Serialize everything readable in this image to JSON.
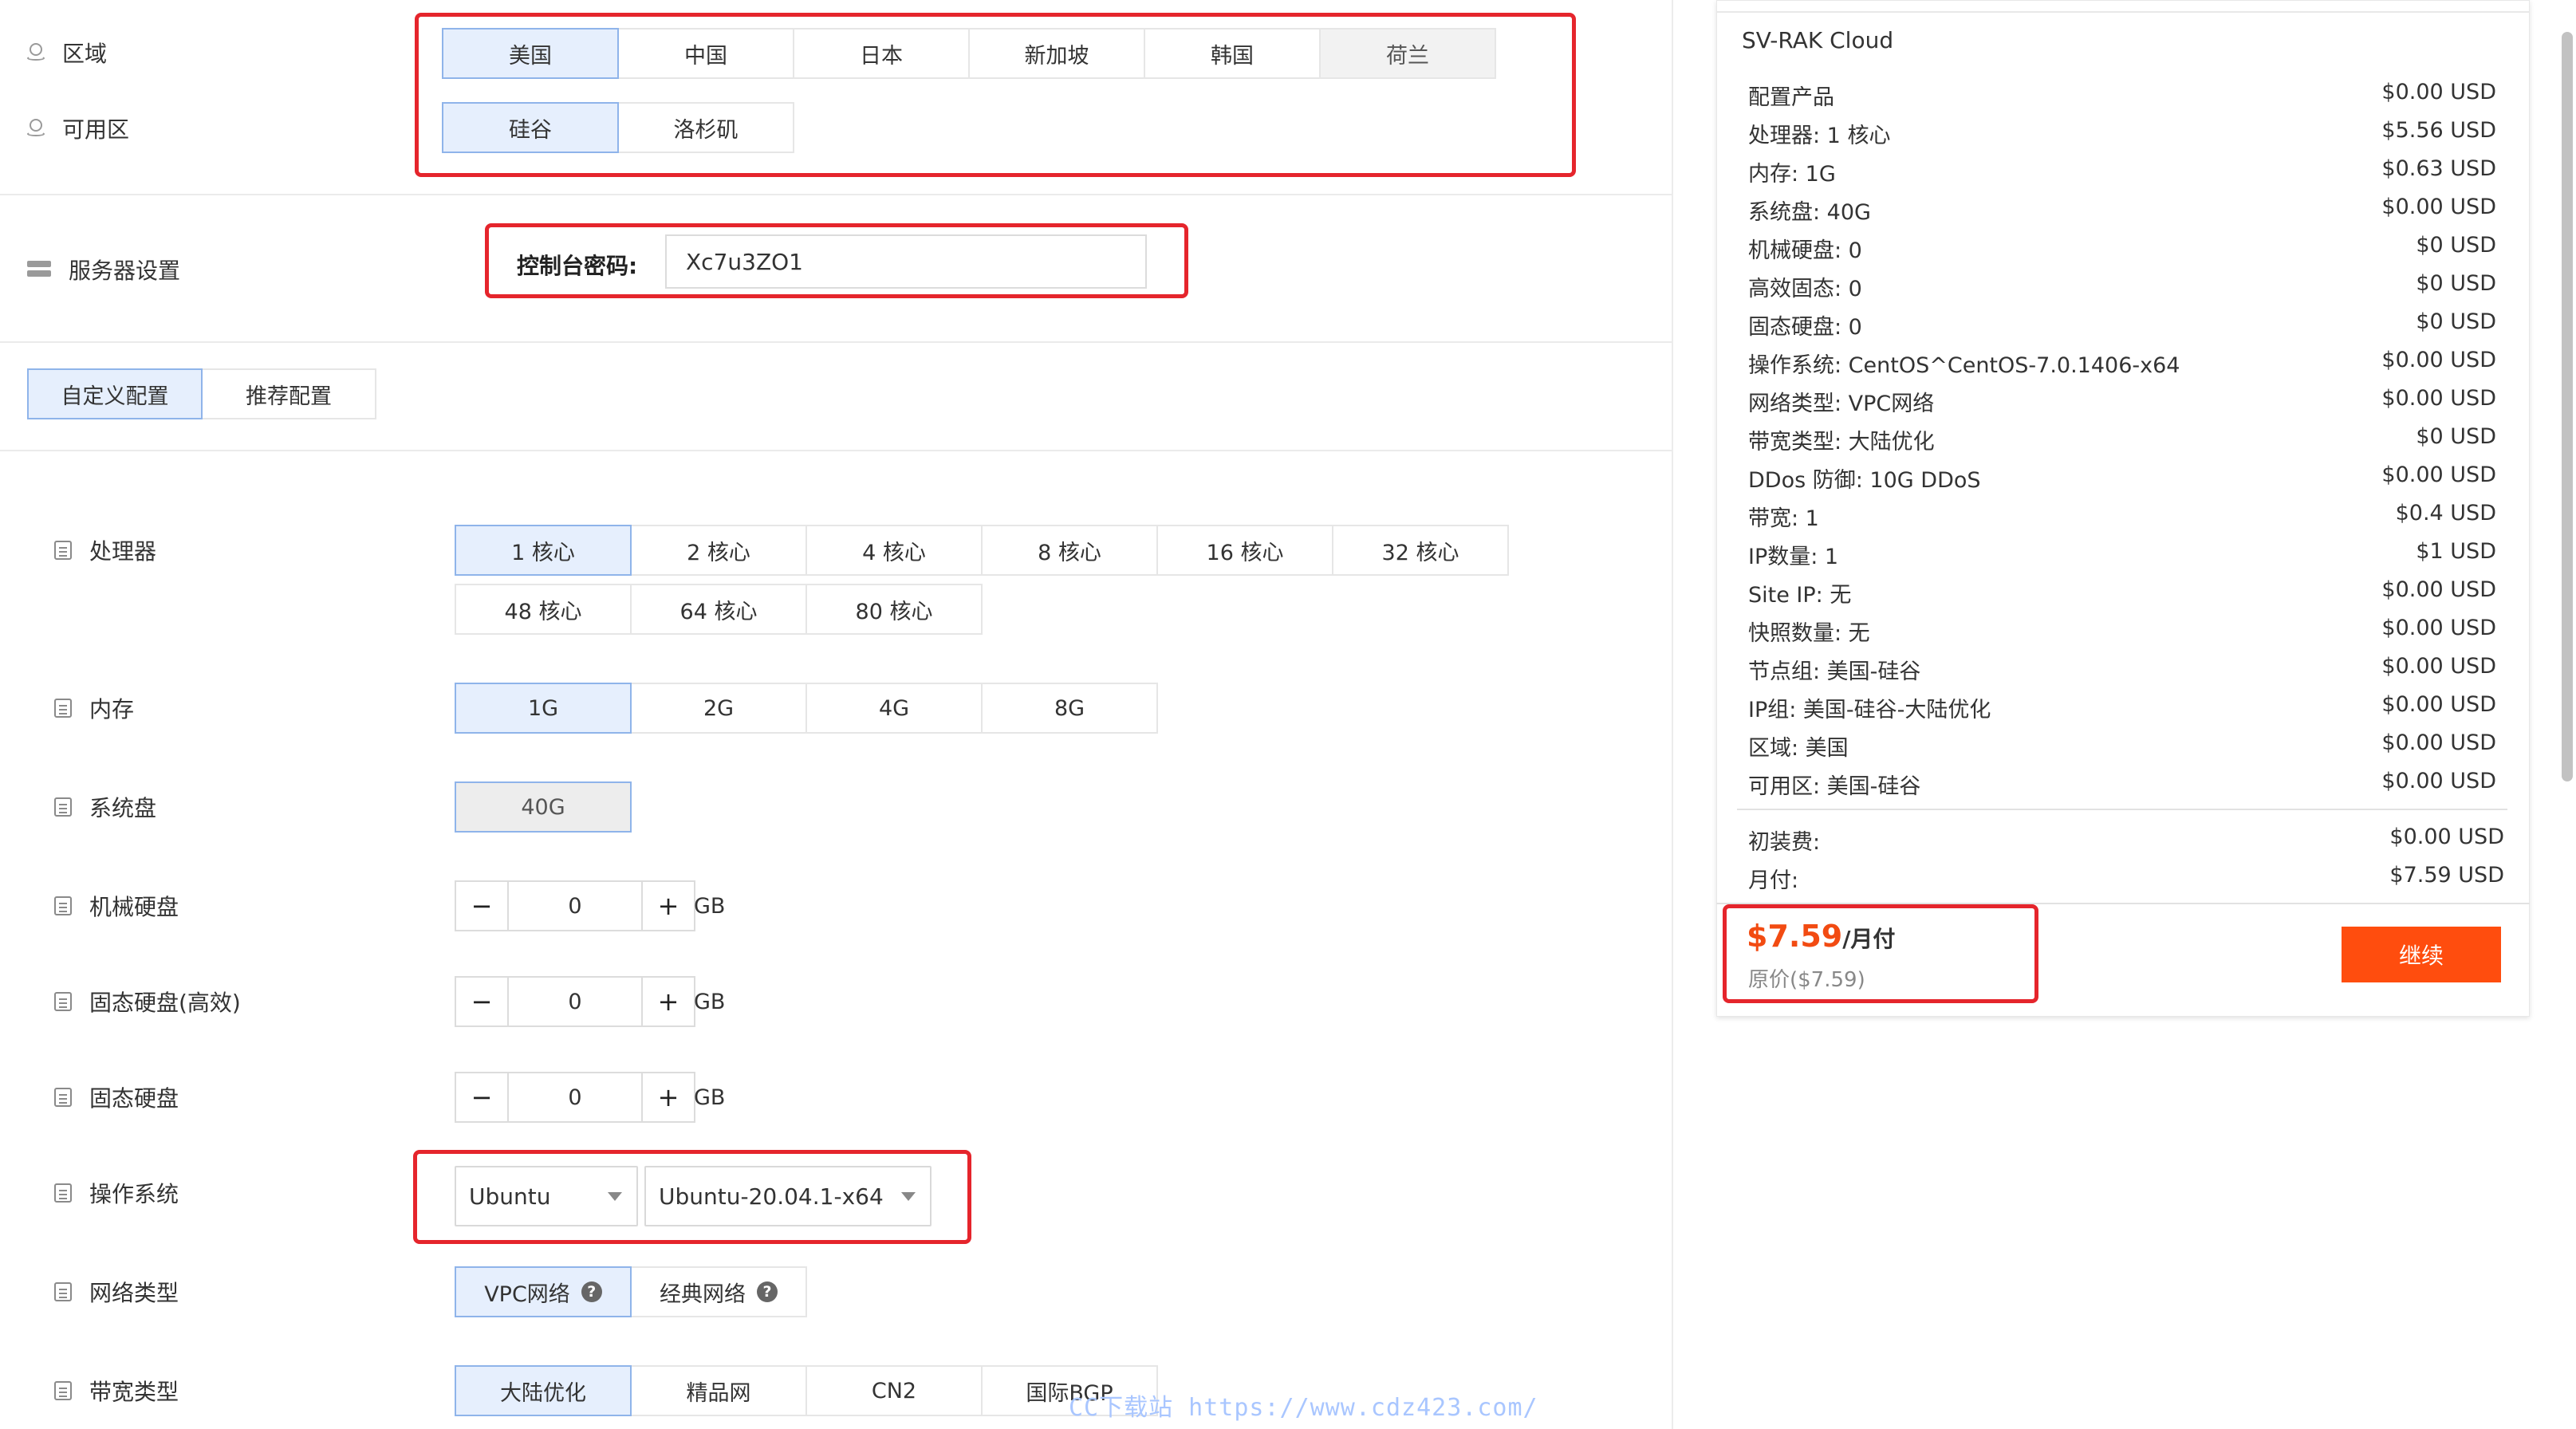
{
  "region": {
    "label": "区域",
    "options": [
      "美国",
      "中国",
      "日本",
      "新加坡",
      "韩国",
      "荷兰"
    ],
    "selected": "美国"
  },
  "zone": {
    "label": "可用区",
    "options": [
      "硅谷",
      "洛杉矶"
    ],
    "selected": "硅谷"
  },
  "server_settings": {
    "label": "服务器设置",
    "password_label": "控制台密码:",
    "password_value": "Xc7u3ZO1"
  },
  "config_tabs": {
    "items": [
      "自定义配置",
      "推荐配置"
    ],
    "selected": "自定义配置"
  },
  "cpu": {
    "label": "处理器",
    "options": [
      "1 核心",
      "2 核心",
      "4 核心",
      "8 核心",
      "16 核心",
      "32 核心",
      "48 核心",
      "64 核心",
      "80 核心"
    ],
    "selected": "1 核心"
  },
  "memory": {
    "label": "内存",
    "options": [
      "1G",
      "2G",
      "4G",
      "8G"
    ],
    "selected": "1G"
  },
  "system_disk": {
    "label": "系统盘",
    "value": "40G"
  },
  "hdd": {
    "label": "机械硬盘",
    "minus": "−",
    "value": "0",
    "plus": "+",
    "unit": "GB"
  },
  "ssd_high": {
    "label": "固态硬盘(高效)",
    "minus": "−",
    "value": "0",
    "plus": "+",
    "unit": "GB"
  },
  "ssd": {
    "label": "固态硬盘",
    "minus": "−",
    "value": "0",
    "plus": "+",
    "unit": "GB"
  },
  "os": {
    "label": "操作系统",
    "family": "Ubuntu",
    "version": "Ubuntu-20.04.1-x64"
  },
  "network": {
    "label": "网络类型",
    "options": [
      "VPC网络",
      "经典网络"
    ],
    "selected": "VPC网络",
    "help_icon": "question-circle-icon"
  },
  "bandwidth_type": {
    "label": "带宽类型",
    "options": [
      "大陆优化",
      "精品网",
      "CN2",
      "国际BGP"
    ],
    "selected": "大陆优化"
  },
  "summary": {
    "title": "SV-RAK Cloud",
    "rows": [
      {
        "k": "配置产品",
        "v": "$0.00 USD"
      },
      {
        "k": "处理器: 1 核心",
        "v": "$5.56 USD"
      },
      {
        "k": "内存: 1G",
        "v": "$0.63 USD"
      },
      {
        "k": "系统盘: 40G",
        "v": "$0.00 USD"
      },
      {
        "k": "机械硬盘: 0",
        "v": "$0 USD"
      },
      {
        "k": "高效固态: 0",
        "v": "$0 USD"
      },
      {
        "k": "固态硬盘: 0",
        "v": "$0 USD"
      },
      {
        "k": "操作系统: CentOS^CentOS-7.0.1406-x64",
        "v": "$0.00 USD"
      },
      {
        "k": "网络类型: VPC网络",
        "v": "$0.00 USD"
      },
      {
        "k": "带宽类型: 大陆优化",
        "v": "$0 USD"
      },
      {
        "k": "DDos 防御: 10G DDoS",
        "v": "$0.00 USD"
      },
      {
        "k": "带宽: 1",
        "v": "$0.4 USD"
      },
      {
        "k": "IP数量: 1",
        "v": "$1 USD"
      },
      {
        "k": "Site IP: 无",
        "v": "$0.00 USD"
      },
      {
        "k": "快照数量: 无",
        "v": "$0.00 USD"
      },
      {
        "k": "节点组: 美国-硅谷",
        "v": "$0.00 USD"
      },
      {
        "k": "IP组: 美国-硅谷-大陆优化",
        "v": "$0.00 USD"
      },
      {
        "k": "区域: 美国",
        "v": "$0.00 USD"
      },
      {
        "k": "可用区: 美国-硅谷",
        "v": "$0.00 USD"
      }
    ],
    "setup_fee_label": "初装费:",
    "setup_fee": "$0.00 USD",
    "monthly_label": "月付:",
    "monthly": "$7.59 USD",
    "price": "$7.59",
    "price_period": "/月付",
    "original_price": "原价($7.59)",
    "continue_label": "继续"
  },
  "watermark": "CC下载站 https://www.cdz423.com/",
  "colors": {
    "selected_bg": "#e6effd",
    "selected_border": "#8fb4ea",
    "highlight_red": "#e5252c",
    "price_orange": "#f24b12",
    "button_orange": "#ff4d0e"
  }
}
